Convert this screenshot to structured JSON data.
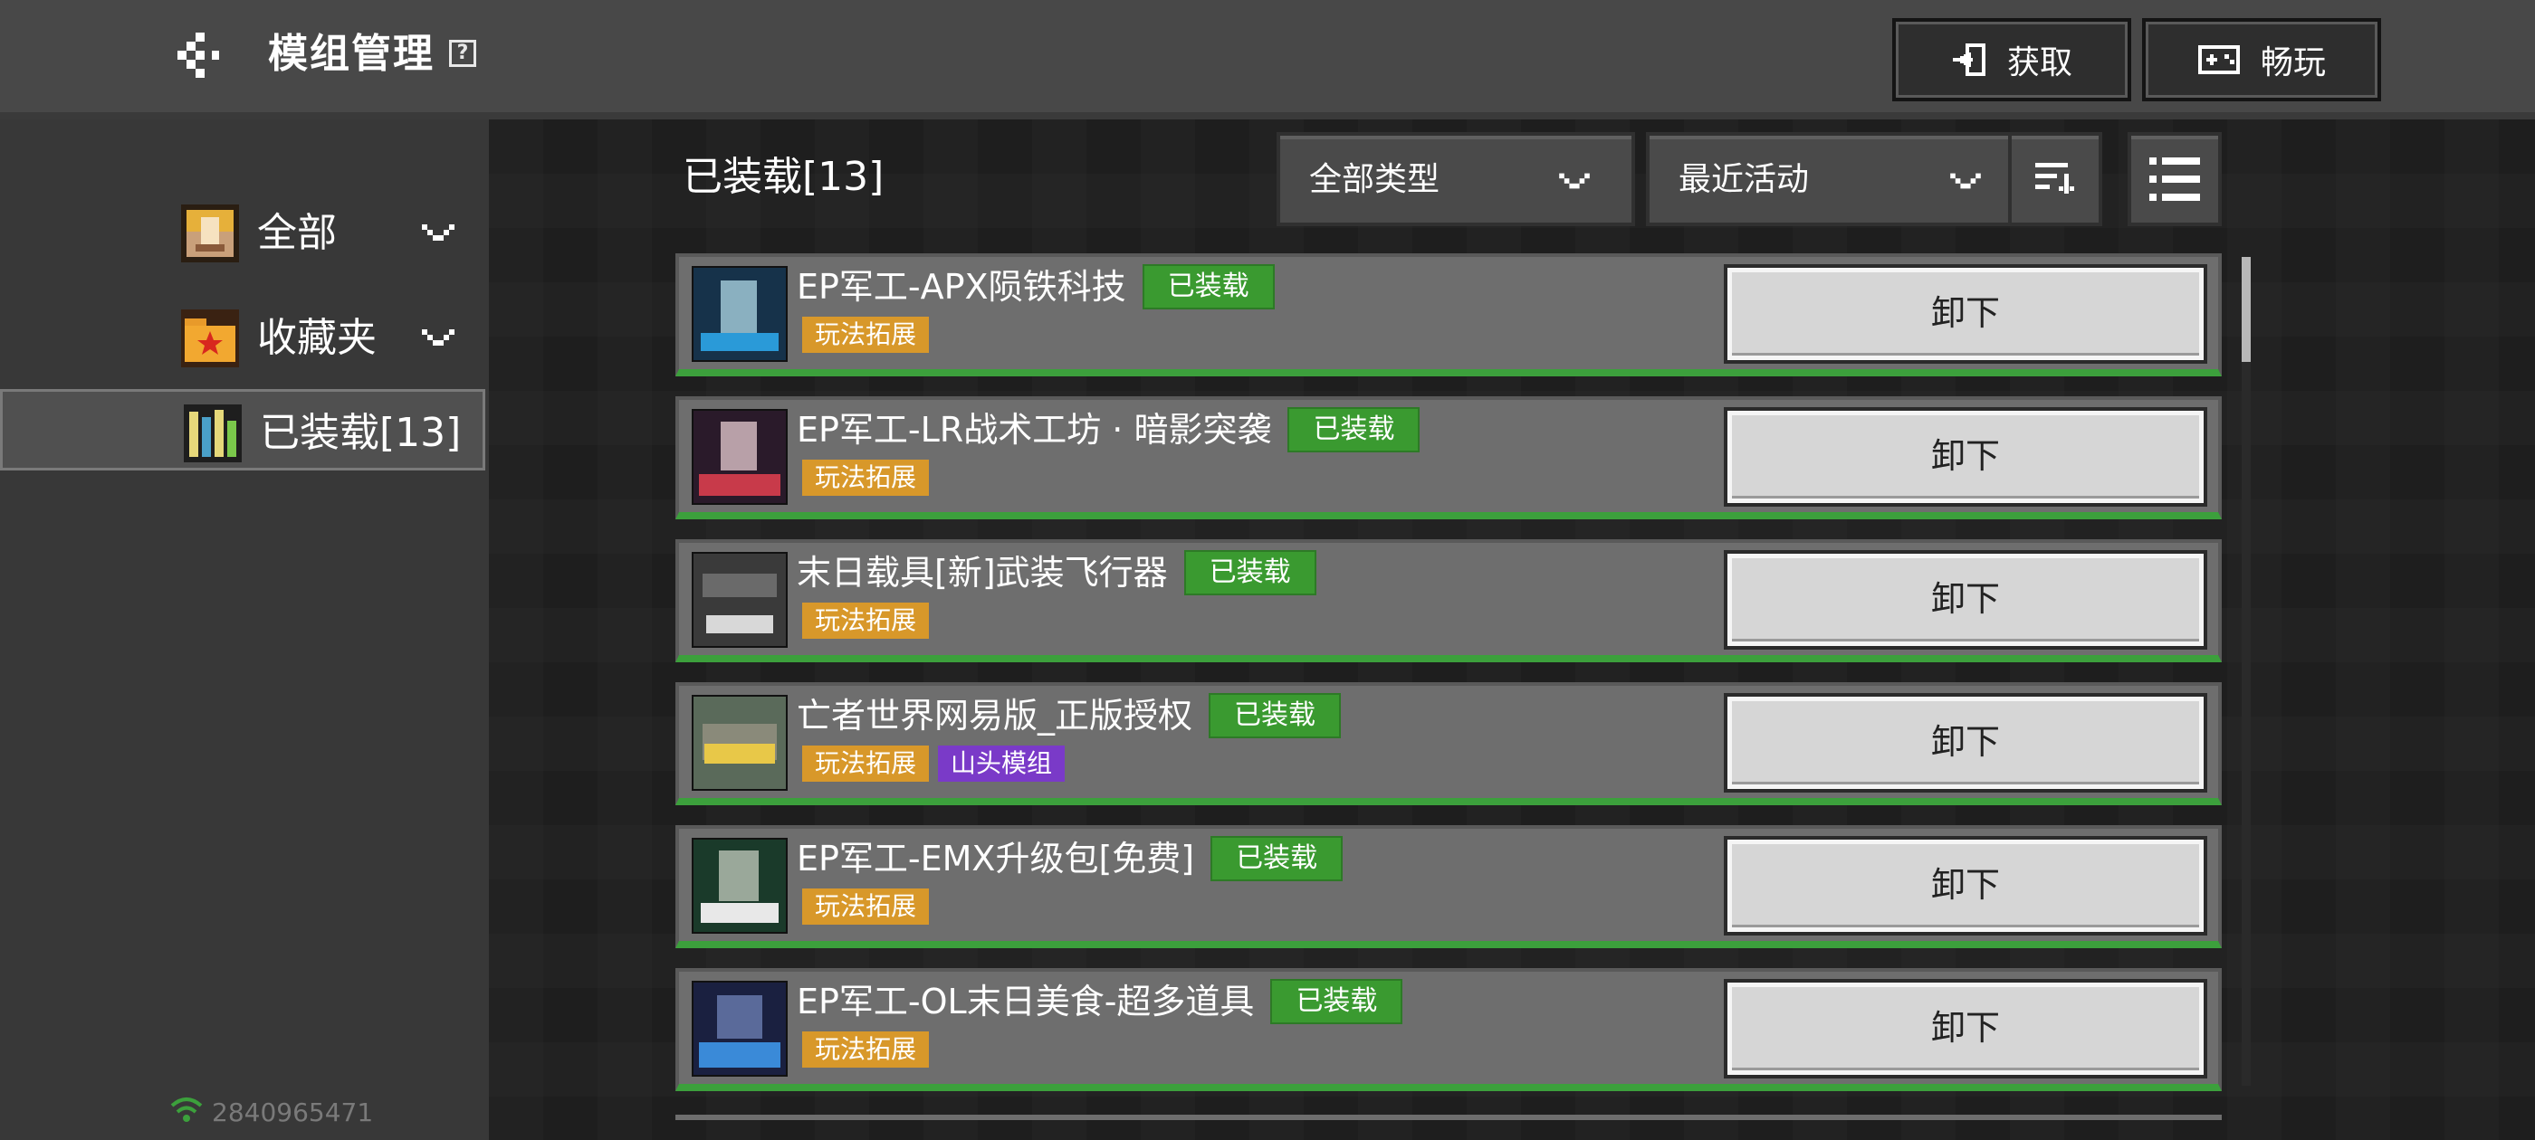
{
  "header": {
    "title": "模组管理",
    "help_glyph": "?",
    "get_label": "获取",
    "play_label": "畅玩"
  },
  "sidebar": {
    "items": [
      {
        "label": "全部",
        "icon": "all-mods-icon"
      },
      {
        "label": "收藏夹",
        "icon": "favorites-folder-icon"
      },
      {
        "label": "已装载[13]",
        "icon": "installed-books-icon"
      }
    ],
    "user_id": "2840965471"
  },
  "main": {
    "installed_title": "已装载[13]",
    "type_filter": "全部类型",
    "sort_filter": "最近活动"
  },
  "mods": [
    {
      "name": "EP军工-APX陨铁科技",
      "status": "已装载",
      "tags": [
        "玩法拓展"
      ],
      "action": "卸下"
    },
    {
      "name": "EP军工-LR战术工坊 · 暗影突袭",
      "status": "已装载",
      "tags": [
        "玩法拓展"
      ],
      "action": "卸下"
    },
    {
      "name": "末日载具[新]武装飞行器",
      "status": "已装载",
      "tags": [
        "玩法拓展"
      ],
      "action": "卸下"
    },
    {
      "name": "亡者世界网易版_正版授权",
      "status": "已装载",
      "tags": [
        "玩法拓展",
        "山头模组"
      ],
      "action": "卸下"
    },
    {
      "name": "EP军工-EMX升级包[免费]",
      "status": "已装载",
      "tags": [
        "玩法拓展"
      ],
      "action": "卸下"
    },
    {
      "name": "EP军工-OL末日美食-超多道具",
      "status": "已装载",
      "tags": [
        "玩法拓展"
      ],
      "action": "卸下"
    }
  ],
  "colors": {
    "installed_badge": "#3a9a30",
    "tag_orange": "#d8982a",
    "tag_purple": "#7a3ac8",
    "accent_green": "#3ca03c"
  }
}
